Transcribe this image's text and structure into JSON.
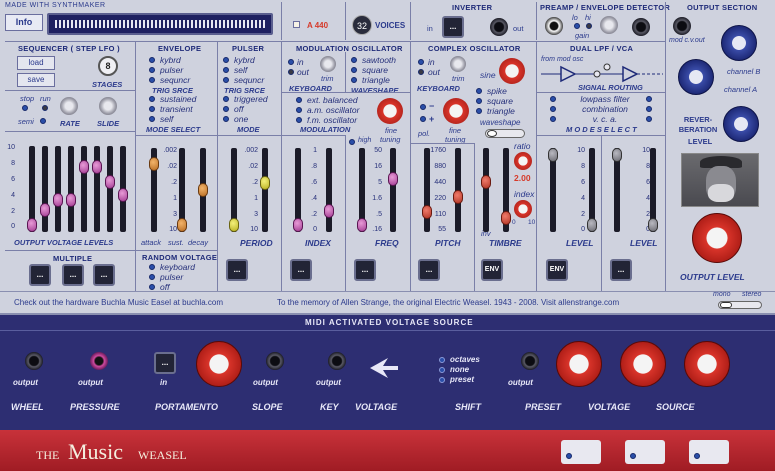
{
  "top": {
    "made_with": "MADE WITH SYNTHMAKER",
    "info": "Info",
    "a440": "A 440",
    "voices_count": "32",
    "voices": "VOICES"
  },
  "inverter": {
    "title": "INVERTER",
    "in": "in",
    "out": "out"
  },
  "preamp": {
    "title": "PREAMP / ENVELOPE DETECTOR",
    "lo": "lo",
    "hi": "hi",
    "gain": "gain"
  },
  "output_section": {
    "title": "OUTPUT SECTION",
    "mod_cv": "mod c.v.out",
    "channel_b": "channel B",
    "channel_a": "channel A",
    "reverb": "REVER-BERATION",
    "level": "LEVEL",
    "output_level": "OUTPUT    LEVEL"
  },
  "sequencer": {
    "title": "SEQUENCER ( STEP LFO )",
    "load": "load",
    "save": "save",
    "stages_num": "8",
    "stages": "STAGES",
    "stop": "stop",
    "run": "run",
    "semi": "semi",
    "rate": "RATE",
    "slide": "SLIDE",
    "levels": "OUTPUT  VOLTAGE  LEVELS",
    "ticks": [
      "10",
      "8",
      "6",
      "4",
      "2",
      "0"
    ],
    "multiple": "MULTIPLE"
  },
  "envelope": {
    "title": "ENVELOPE",
    "trig_opts": [
      "kybrd",
      "pulser",
      "sequncr"
    ],
    "trig_src": "TRIG SRCE",
    "mode_opts": [
      "sustained",
      "transient",
      "self"
    ],
    "mode_select": "MODE SELECT",
    "ticks": [
      ".002",
      ".02",
      ".2",
      "1",
      "3",
      "10"
    ],
    "attack": "attack",
    "sust": "sust.",
    "decay": "decay"
  },
  "random": {
    "title": "RANDOM VOLTAGE",
    "opts": [
      "keyboard",
      "pulser",
      "off"
    ]
  },
  "pulser": {
    "title": "PULSER",
    "trig_opts": [
      "kybrd",
      "self",
      "sequncr"
    ],
    "trig_src": "TRIG SRCE",
    "mode_opts": [
      "triggered",
      "off",
      "one"
    ],
    "mode": "MODE",
    "ticks": [
      ".002",
      ".02",
      ".2",
      "1",
      "3",
      "10"
    ],
    "period": "PERIOD"
  },
  "modosc": {
    "title": "MODULATION  OSCILLATOR",
    "in": "in",
    "out": "out",
    "trim": "trim",
    "keyboard": "KEYBOARD",
    "wave_opts": [
      "sawtooth",
      "square",
      "triangle"
    ],
    "waveshape": "WAVESHAPE",
    "mod_opts": [
      "ext. balanced",
      "a.m. oscillator",
      "f.m. oscillator"
    ],
    "modulation": "MODULATION",
    "high": "high",
    "fine": "fine",
    "tuning": "tuning",
    "index_ticks": [
      "1",
      ".8",
      ".6",
      ".4",
      ".2",
      "0"
    ],
    "index": "INDEX",
    "freq_ticks": [
      "50",
      "16",
      "5",
      "1.6",
      ".5",
      ".16"
    ],
    "freq": "FREQ"
  },
  "complexosc": {
    "title": "COMPLEX  OSCILLATOR",
    "in": "in",
    "out": "out",
    "trim": "trim",
    "keyboard": "KEYBOARD",
    "sine": "sine",
    "wave_opts": [
      "spike",
      "square",
      "triangle"
    ],
    "waveshape": "waveshape",
    "pol": "pol.",
    "fine": "fine",
    "tuning": "tuning",
    "pitch_ticks": [
      "1760",
      "880",
      "440",
      "220",
      "110",
      "55"
    ],
    "pitch": "PITCH",
    "inv": "inv",
    "ratio": "ratio",
    "ratio_val": "2.00",
    "index": "index",
    "timbre": "TIMBRE",
    "idx0": "0",
    "idx10": "10"
  },
  "lpf": {
    "title": "DUAL  LPF / VCA",
    "from_mod": "from mod osc",
    "routing": "SIGNAL  ROUTING",
    "mode_opts": [
      "lowpass  filter",
      "combination",
      "v. c. a."
    ],
    "mode_select": "M O D E   S E L E C T",
    "ticks": [
      "10",
      "8",
      "6",
      "4",
      "2",
      "0"
    ],
    "level": "LEVEL",
    "env": "ENV"
  },
  "footer": {
    "left": "Check out the hardware Buchla Music Easel at buchla.com",
    "right": "To the memory of Allen Strange, the original Electric Weasel.   1943 - 2008.   Visit allenstrange.com",
    "mono": "mono",
    "stereo": "stereo"
  },
  "midi": {
    "title": "MIDI   ACTIVATED   VOLTAGE   SOURCE",
    "wheel": "WHEEL",
    "pressure": "PRESSURE",
    "portamento": "PORTAMENTO",
    "slope": "SLOPE",
    "key": "KEY",
    "voltage": "VOLTAGE",
    "shift": "SHIFT",
    "preset": "PRESET",
    "source": "SOURCE",
    "output": "output",
    "in": "in",
    "shift_opts": [
      "octaves",
      "none",
      "preset"
    ]
  },
  "brand": {
    "the": "THE",
    "music": "Music",
    "weasel": "WEASEL"
  },
  "button_text": "...",
  "colors": {
    "panel": "#cfd2de",
    "midi_bg": "#2d2e72",
    "brand_bar": "#b8232a",
    "label": "#2b3a8c"
  }
}
